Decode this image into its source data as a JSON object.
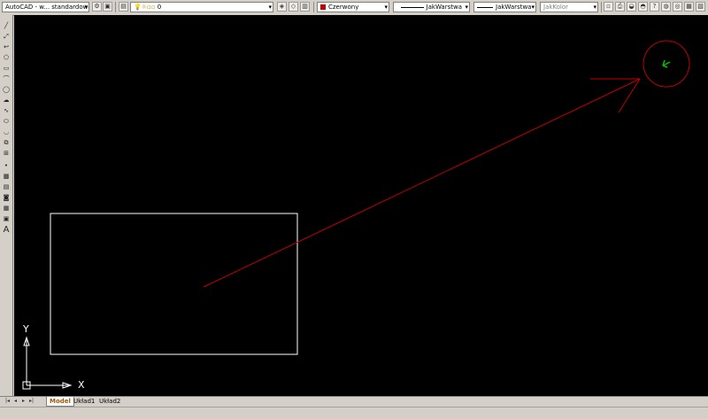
{
  "toolbar": {
    "workspace": "AutoCAD - w... standardowe",
    "layer": "0",
    "color": "Czerwony",
    "linetype": "JakWarstwa",
    "lineweight": "JakWarstwa",
    "plotstyle": "JakKolor",
    "accent": "#c00000"
  },
  "ucs": {
    "x_label": "X",
    "y_label": "Y"
  },
  "left_toolbar": {
    "icons": [
      "line-icon",
      "construction-line-icon",
      "polyline-icon",
      "polygon-icon",
      "rectangle-icon",
      "arc-icon",
      "circle-icon",
      "revision-cloud-icon",
      "spline-icon",
      "ellipse-icon",
      "ellipse-arc-icon",
      "insert-block-icon",
      "make-block-icon",
      "point-icon",
      "hatch-icon",
      "gradient-icon",
      "region-icon",
      "table-icon",
      "multiline-text-icon"
    ],
    "text_tool": "A"
  },
  "tabs": [
    "Model",
    "Układ1",
    "Układ2"
  ],
  "colors": {
    "canvas": "#000000",
    "drawing_red": "#c00000",
    "rectangle": "#ffffff",
    "cursor": "#00c000"
  }
}
